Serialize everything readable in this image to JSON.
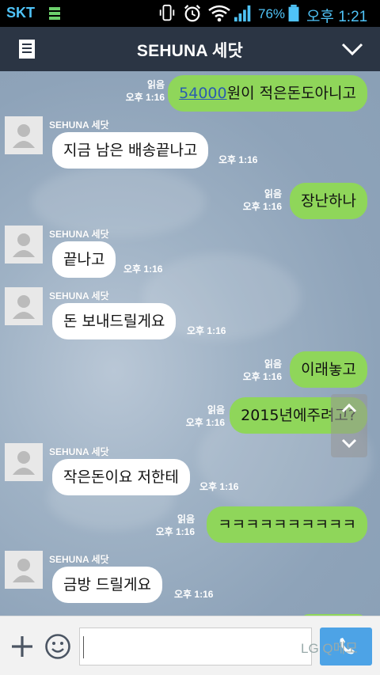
{
  "status_bar": {
    "carrier": "SKT",
    "battery_pct": "76%",
    "clock": "오후 1:21"
  },
  "header": {
    "title": "SEHUNA 세닷"
  },
  "messages": [
    {
      "side": "out",
      "read": "읽음",
      "time": "오후 1:16",
      "link_text": "54000",
      "text": "원이 적은돈도아니고"
    },
    {
      "side": "in",
      "sender": "SEHUNA 세닷",
      "text": "지금 남은 배송끝나고",
      "time": "오후 1:16"
    },
    {
      "side": "out",
      "read": "읽음",
      "time": "오후 1:16",
      "text": "장난하나"
    },
    {
      "side": "in",
      "sender": "SEHUNA 세닷",
      "text": "끝나고",
      "time": "오후 1:16"
    },
    {
      "side": "in",
      "sender": "SEHUNA 세닷",
      "text": "돈 보내드릴게요",
      "time": "오후 1:16"
    },
    {
      "side": "out",
      "read": "읽음",
      "time": "오후 1:16",
      "text": "이래놓고"
    },
    {
      "side": "out",
      "read": "읽음",
      "time": "오후 1:16",
      "text": "2015년에주려고?"
    },
    {
      "side": "in",
      "sender": "SEHUNA 세닷",
      "text": "작은돈이요 저한테",
      "time": "오후 1:16"
    },
    {
      "side": "out",
      "read": "읽음",
      "time": "오후 1:16",
      "text": "ㅋㅋㅋㅋㅋㅋㅋㅋㅋㅋ"
    },
    {
      "side": "in",
      "sender": "SEHUNA 세닷",
      "text": "금방 드릴게요",
      "time": "오후 1:16"
    }
  ],
  "input_bar": {
    "watermark": "LG Q메모"
  },
  "colors": {
    "header_bg": "#2b3544",
    "outgoing_bubble": "#8fd65a",
    "incoming_bubble": "#ffffff",
    "status_accent": "#4fc3f7"
  },
  "icons": {
    "menu": "menu-icon",
    "collapse": "chevron-down-icon",
    "plus": "plus-icon",
    "emoji": "emoji-icon",
    "send": "phone-send-icon"
  }
}
